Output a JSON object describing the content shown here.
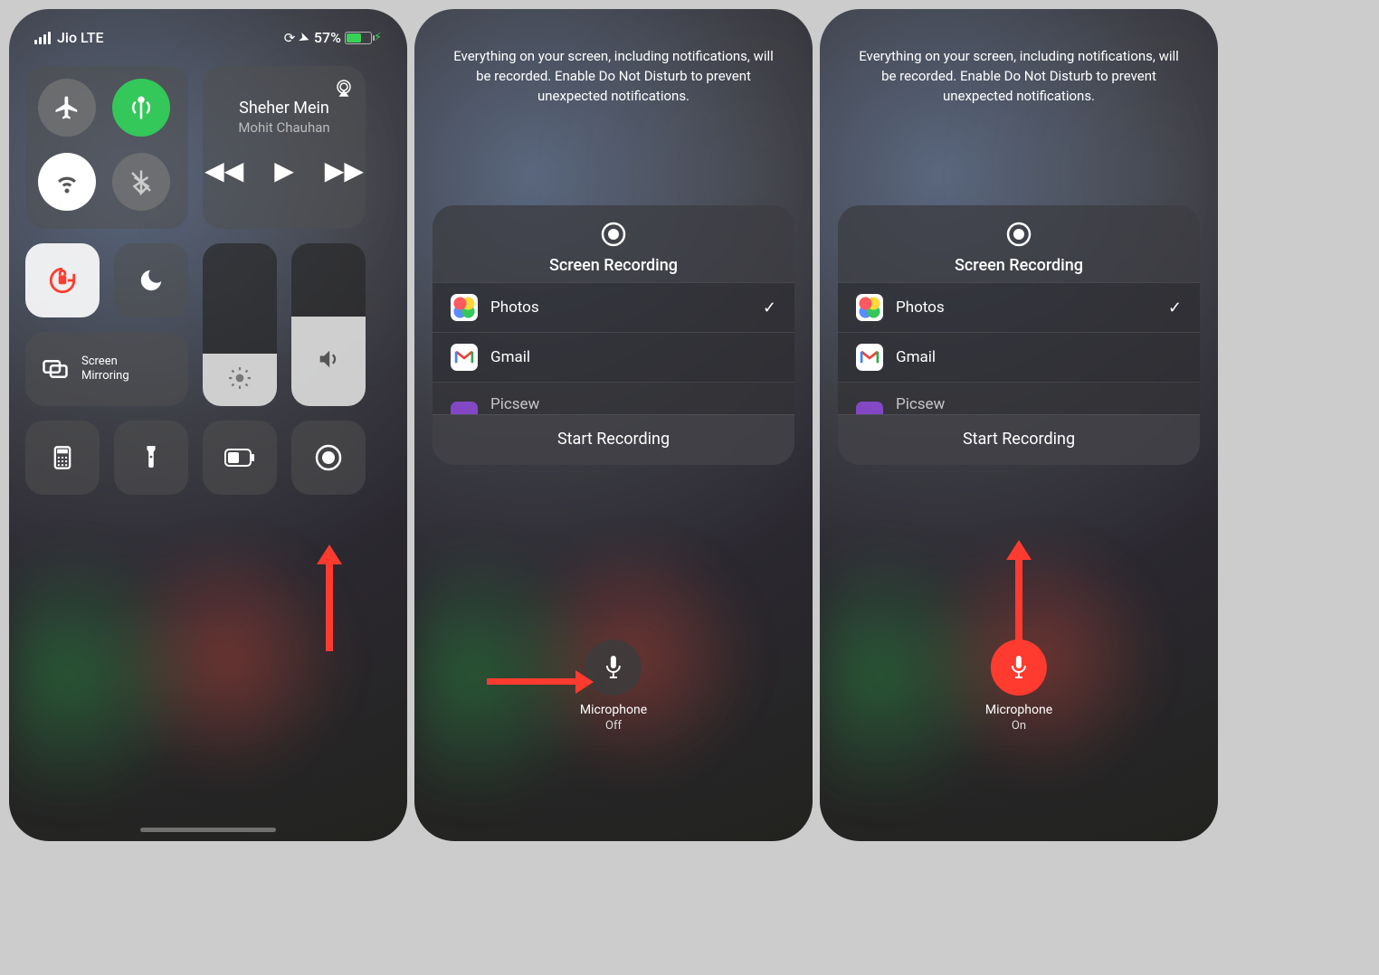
{
  "status": {
    "carrier": "Jio LTE",
    "battery_pct": "57%"
  },
  "media": {
    "title": "Sheher Mein",
    "artist": "Mohit Chauhan"
  },
  "mirror_label_1": "Screen",
  "mirror_label_2": "Mirroring",
  "recording": {
    "info": "Everything on your screen, including notifications, will be recorded. Enable Do Not Disturb to prevent unexpected notifications.",
    "title": "Screen Recording",
    "apps": {
      "photos": "Photos",
      "gmail": "Gmail",
      "third": "Picsew"
    },
    "start": "Start Recording",
    "mic_label": "Microphone",
    "mic_off": "Off",
    "mic_on": "On"
  }
}
